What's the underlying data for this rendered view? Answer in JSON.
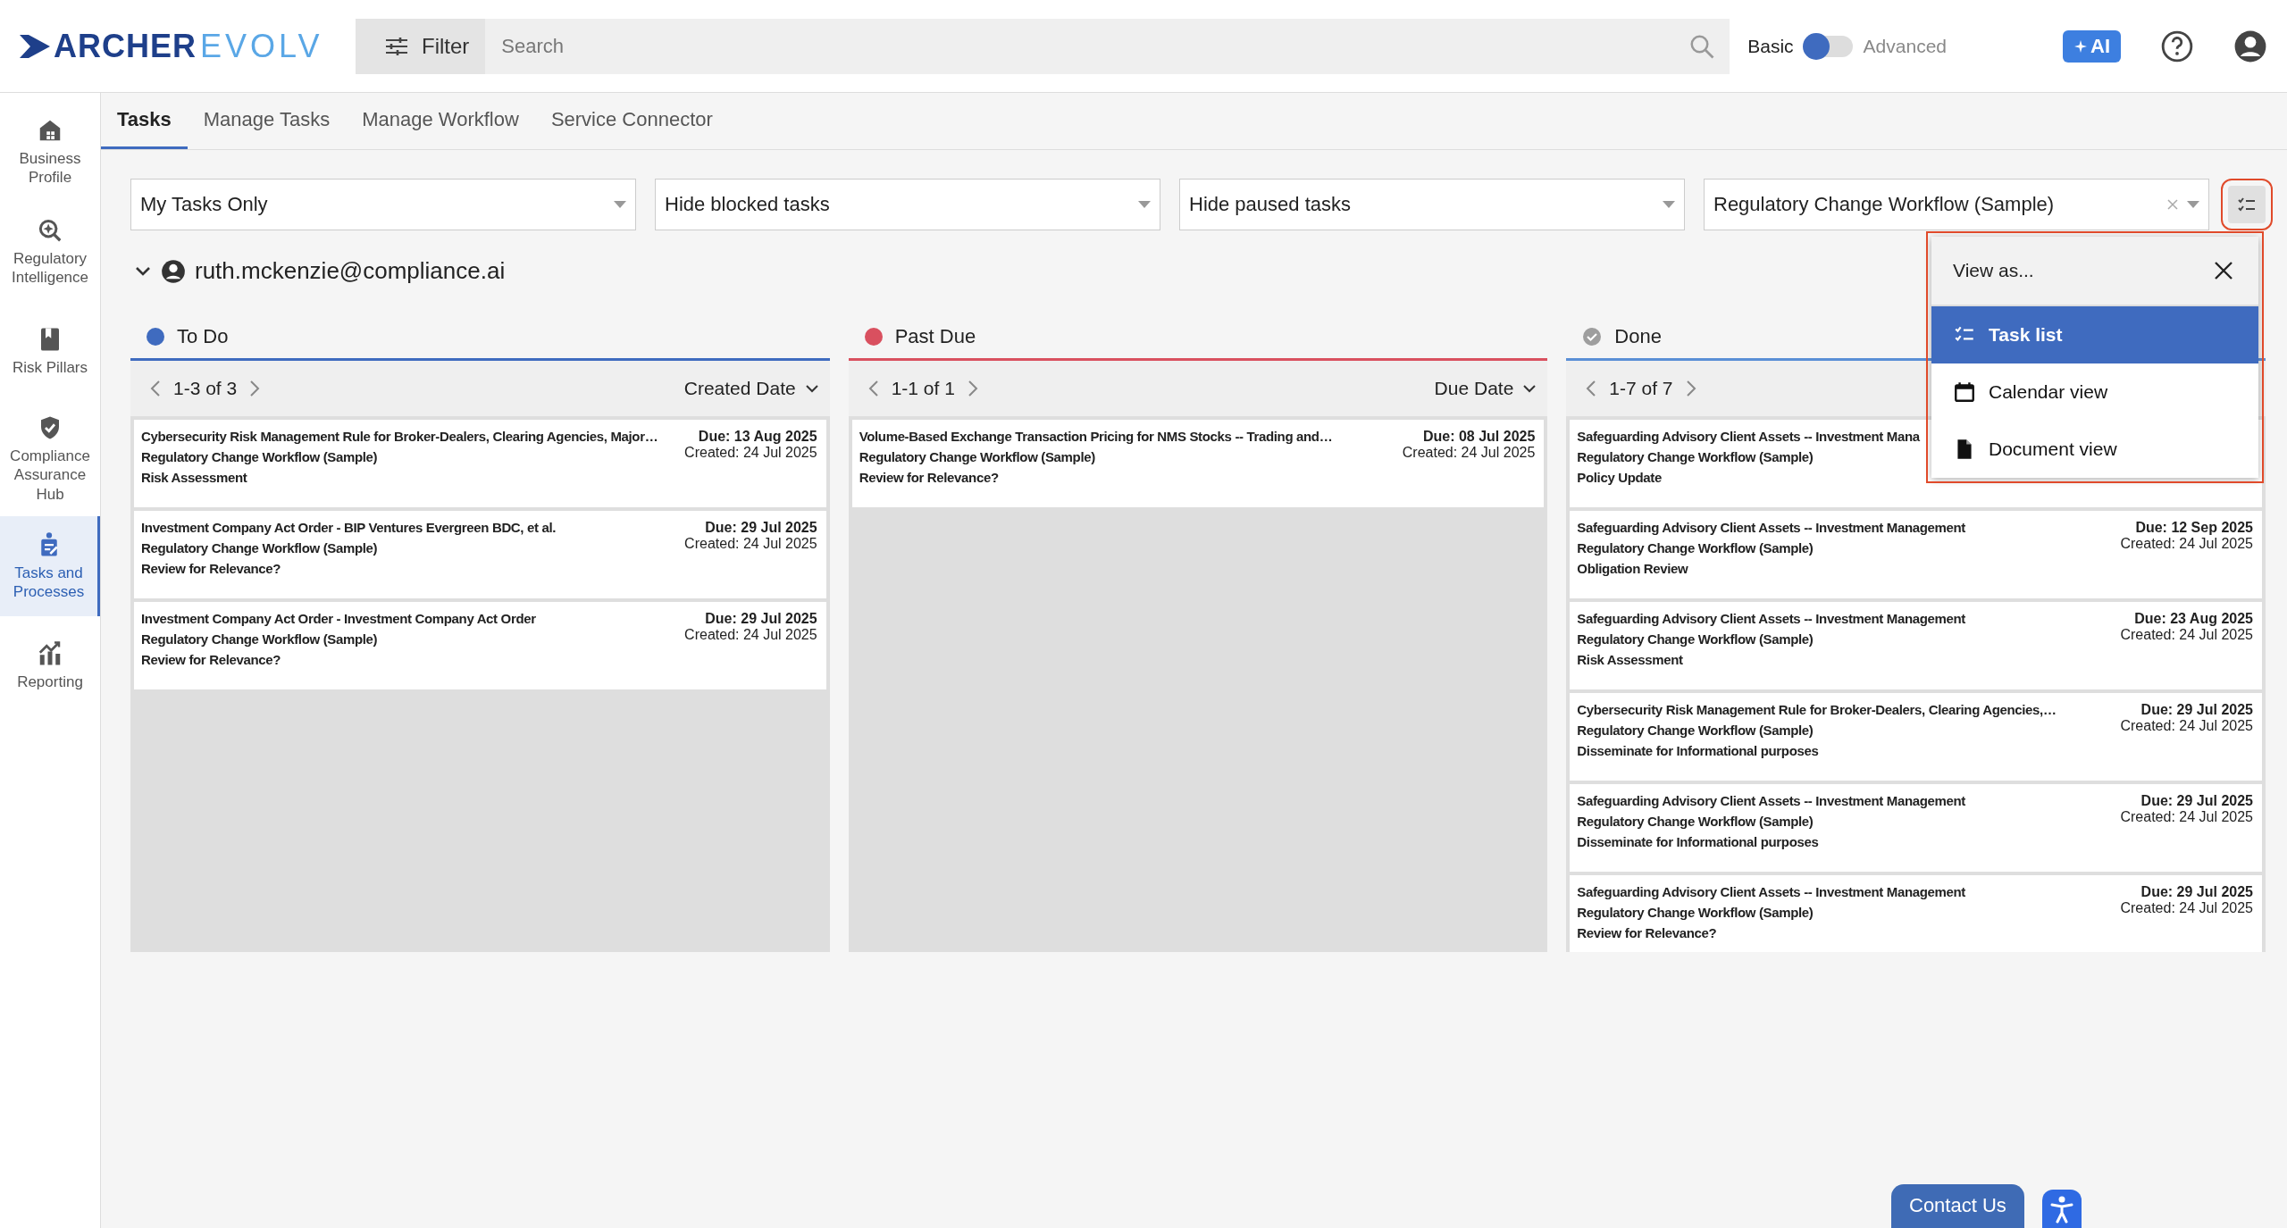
{
  "header": {
    "logo": {
      "brand": "ARCHER",
      "product": "EVOLV"
    },
    "filter_button": "Filter",
    "search": {
      "placeholder": "Search"
    },
    "mode_toggle": {
      "left_label": "Basic",
      "right_label": "Advanced",
      "on": false
    },
    "ai_button": "AI"
  },
  "sidebar": {
    "items": [
      {
        "label": "Business Profile",
        "selected": false
      },
      {
        "label": "Regulatory Intelligence",
        "selected": false
      },
      {
        "label": "Risk Pillars",
        "selected": false
      },
      {
        "label": "Compliance Assurance Hub",
        "selected": false
      },
      {
        "label": "Tasks and Processes",
        "selected": true
      },
      {
        "label": "Reporting",
        "selected": false
      }
    ]
  },
  "tabs": [
    {
      "label": "Tasks",
      "selected": true
    },
    {
      "label": "Manage Tasks",
      "selected": false
    },
    {
      "label": "Manage Workflow",
      "selected": false
    },
    {
      "label": "Service Connector",
      "selected": false
    }
  ],
  "filters": [
    {
      "value": "My Tasks Only",
      "clearable": false
    },
    {
      "value": "Hide blocked tasks",
      "clearable": false
    },
    {
      "value": "Hide paused tasks",
      "clearable": false
    },
    {
      "value": "Regulatory Change Workflow (Sample)",
      "clearable": true
    }
  ],
  "user": {
    "email": "ruth.mckenzie@compliance.ai",
    "expanded": true
  },
  "columns": [
    {
      "title": "To Do",
      "kind": "dot",
      "color": "#3f6bbf",
      "pager": "1-3 of 3",
      "sort": "Created Date",
      "cards": [
        {
          "title": "Cybersecurity Risk Management Rule for Broker-Dealers, Clearing Agencies, Major…",
          "workflow": "Regulatory Change Workflow (Sample)",
          "step": "Risk Assessment",
          "due": "Due: 13 Aug 2025",
          "created": "Created: 24 Jul 2025"
        },
        {
          "title": "Investment Company Act Order - BIP Ventures Evergreen BDC, et al.",
          "workflow": "Regulatory Change Workflow (Sample)",
          "step": "Review for Relevance?",
          "due": "Due: 29 Jul 2025",
          "created": "Created: 24 Jul 2025"
        },
        {
          "title": "Investment Company Act Order - Investment Company Act Order",
          "workflow": "Regulatory Change Workflow (Sample)",
          "step": "Review for Relevance?",
          "due": "Due: 29 Jul 2025",
          "created": "Created: 24 Jul 2025"
        }
      ]
    },
    {
      "title": "Past Due",
      "kind": "dot",
      "color": "#d9505f",
      "pager": "1-1 of 1",
      "sort": "Due Date",
      "cards": [
        {
          "title": "Volume-Based Exchange Transaction Pricing for NMS Stocks -- Trading and…",
          "workflow": "Regulatory Change Workflow (Sample)",
          "step": "Review for Relevance?",
          "due": "Due: 08 Jul 2025",
          "created": "Created: 24 Jul 2025"
        }
      ]
    },
    {
      "title": "Done",
      "kind": "check",
      "color": "#9e9e9e",
      "pager": "1-7 of 7",
      "cards": [
        {
          "title": "Safeguarding Advisory Client Assets -- Investment Mana",
          "workflow": "Regulatory Change Workflow (Sample)",
          "step": "Policy Update"
        },
        {
          "title": "Safeguarding Advisory Client Assets -- Investment Management",
          "workflow": "Regulatory Change Workflow (Sample)",
          "step": "Obligation Review",
          "due": "Due: 12 Sep 2025",
          "created": "Created: 24 Jul 2025"
        },
        {
          "title": "Safeguarding Advisory Client Assets -- Investment Management",
          "workflow": "Regulatory Change Workflow (Sample)",
          "step": "Risk Assessment",
          "due": "Due: 23 Aug 2025",
          "created": "Created: 24 Jul 2025"
        },
        {
          "title": "Cybersecurity Risk Management Rule for Broker-Dealers, Clearing Agencies,…",
          "workflow": "Regulatory Change Workflow (Sample)",
          "step": "Disseminate for Informational purposes",
          "due": "Due: 29 Jul 2025",
          "created": "Created: 24 Jul 2025"
        },
        {
          "title": "Safeguarding Advisory Client Assets -- Investment Management",
          "workflow": "Regulatory Change Workflow (Sample)",
          "step": "Disseminate for Informational purposes",
          "due": "Due: 29 Jul 2025",
          "created": "Created: 24 Jul 2025"
        },
        {
          "title": "Safeguarding Advisory Client Assets -- Investment Management",
          "workflow": "Regulatory Change Workflow (Sample)",
          "step": "Review for Relevance?",
          "due": "Due: 29 Jul 2025",
          "created": "Created: 24 Jul 2025"
        }
      ]
    }
  ],
  "view_menu": {
    "title": "View as...",
    "options": [
      {
        "label": "Task list",
        "selected": true
      },
      {
        "label": "Calendar view",
        "selected": false
      },
      {
        "label": "Document view",
        "selected": false
      }
    ]
  },
  "contact_button": "Contact Us"
}
